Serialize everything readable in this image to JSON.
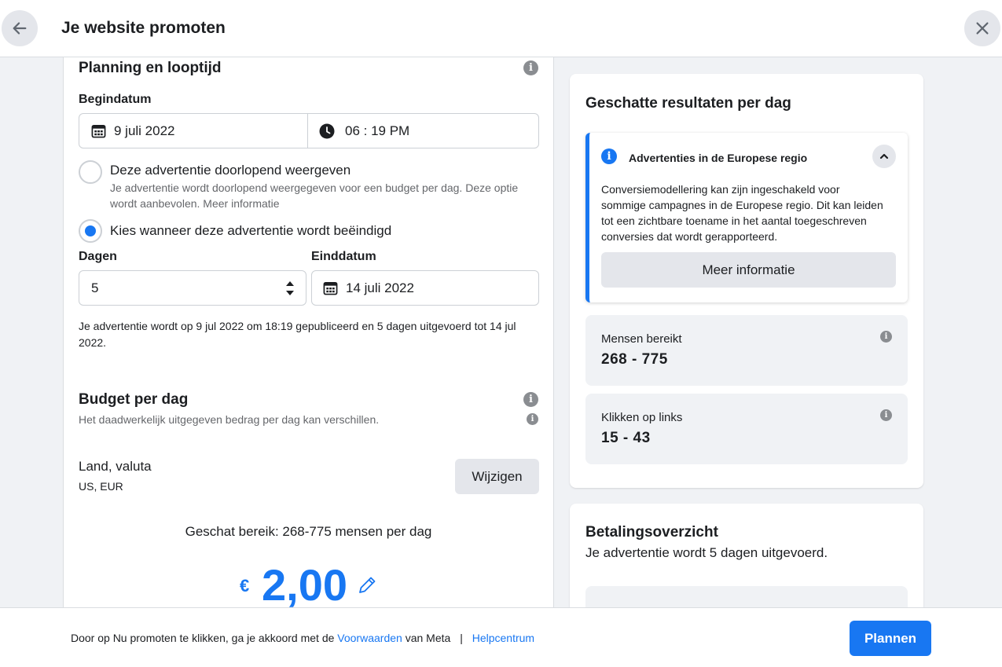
{
  "header": {
    "title": "Je website promoten"
  },
  "planning": {
    "title": "Planning en looptijd",
    "start_label": "Begindatum",
    "start_date": "9 juli 2022",
    "start_time": "06 : 19 PM",
    "option_continuous": {
      "label": "Deze advertentie doorlopend weergeven",
      "description": "Je advertentie wordt doorlopend weergegeven voor een budget per dag. Deze optie wordt aanbevolen. Meer informatie",
      "selected": false
    },
    "option_end": {
      "label": "Kies wanneer deze advertentie wordt beëindigd",
      "selected": true
    },
    "days_label": "Dagen",
    "days_value": "5",
    "end_label": "Einddatum",
    "end_date": "14 juli 2022",
    "summary": "Je advertentie wordt op 9 jul 2022 om 18:19 gepubliceerd en 5 dagen uitgevoerd tot 14 jul 2022."
  },
  "budget": {
    "title": "Budget per dag",
    "subtitle": "Het daadwerkelijk uitgegeven bedrag per dag kan verschillen.",
    "country_label": "Land, valuta",
    "country_value": "US, EUR",
    "change_button": "Wijzigen",
    "estimated_reach": "Geschat bereik: 268-775 mensen per dag",
    "currency_symbol": "€",
    "amount": "2,00"
  },
  "results": {
    "title": "Geschatte resultaten per dag",
    "notice": {
      "title": "Advertenties in de Europese regio",
      "body": "Conversiemodellering kan zijn ingeschakeld voor sommige campagnes in de Europese regio. Dit kan leiden tot een zichtbare toename in het aantal toegeschreven conversies dat wordt gerapporteerd.",
      "button": "Meer informatie"
    },
    "reach": {
      "label": "Mensen bereikt",
      "value": "268 - 775"
    },
    "clicks": {
      "label": "Klikken op links",
      "value": "15 - 43"
    }
  },
  "payment": {
    "title": "Betalingsoverzicht",
    "subtitle": "Je advertentie wordt 5 dagen uitgevoerd."
  },
  "footer": {
    "text_before": "Door op Nu promoten te klikken, ga je akkoord met de ",
    "terms_link": "Voorwaarden",
    "text_after": " van Meta",
    "separator": "|",
    "help_link": "Helpcentrum",
    "primary_button": "Plannen"
  },
  "colors": {
    "accent": "#1877f2",
    "background": "#f0f2f5",
    "info_icon": "#8a8d91"
  },
  "icons": {
    "back": "arrow-left-icon",
    "close": "close-icon",
    "info": "info-icon",
    "calendar": "calendar-icon",
    "clock": "clock-icon",
    "stepper": "stepper-arrows-icon",
    "chevron": "chevron-up-icon",
    "edit": "pencil-icon"
  }
}
